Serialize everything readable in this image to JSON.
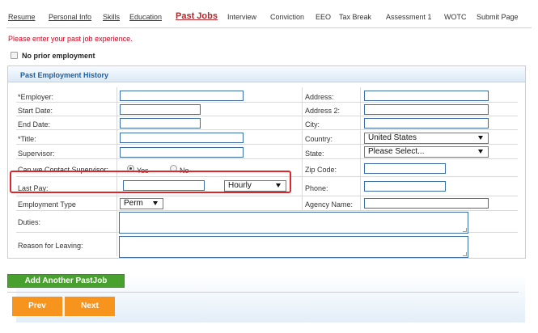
{
  "nav": {
    "items": [
      {
        "label": "Resume"
      },
      {
        "label": "Personal Info"
      },
      {
        "label": "Skills"
      },
      {
        "label": "Education"
      },
      {
        "label": "Past Jobs"
      },
      {
        "label": "Interview"
      },
      {
        "label": "Conviction"
      },
      {
        "label": "EEO"
      },
      {
        "label": "Tax Break"
      },
      {
        "label": "Assessment 1"
      },
      {
        "label": "WOTC"
      },
      {
        "label": "Submit Page"
      }
    ]
  },
  "instruction": "Please enter your past job experience.",
  "no_prior": {
    "label": "No prior employment",
    "checked": false
  },
  "panel": {
    "title": "Past Employment History",
    "left_labels": {
      "employer": "*Employer:",
      "start_date": "Start Date:",
      "end_date": "End Date:",
      "title": "*Title:",
      "supervisor": "Supervisor:",
      "contact_supervisor": "Can we Contact Supervisor:",
      "last_pay": "Last Pay:",
      "employment_type": "Employment Type",
      "duties": "Duties:",
      "reason": "Reason for Leaving:"
    },
    "right_labels": {
      "address": "Address:",
      "address2": "Address 2:",
      "city": "City:",
      "country": "Country:",
      "state": "State:",
      "zip": "Zip Code:",
      "phone": "Phone:",
      "agency": "Agency Name:"
    },
    "contact_options": {
      "yes": "Yes",
      "no": "No",
      "selected": "yes"
    },
    "pay_period": "Hourly",
    "employment_type_value": "Perm",
    "country_value": "United States",
    "state_value": "Please Select..."
  },
  "buttons": {
    "add_another": "Add Another PastJob",
    "prev": "Prev",
    "next": "Next"
  },
  "colors": {
    "accent_red": "#b8262b",
    "panel_title": "#1f5f9c",
    "green_button": "#48a12e",
    "orange_button": "#f7941d"
  }
}
